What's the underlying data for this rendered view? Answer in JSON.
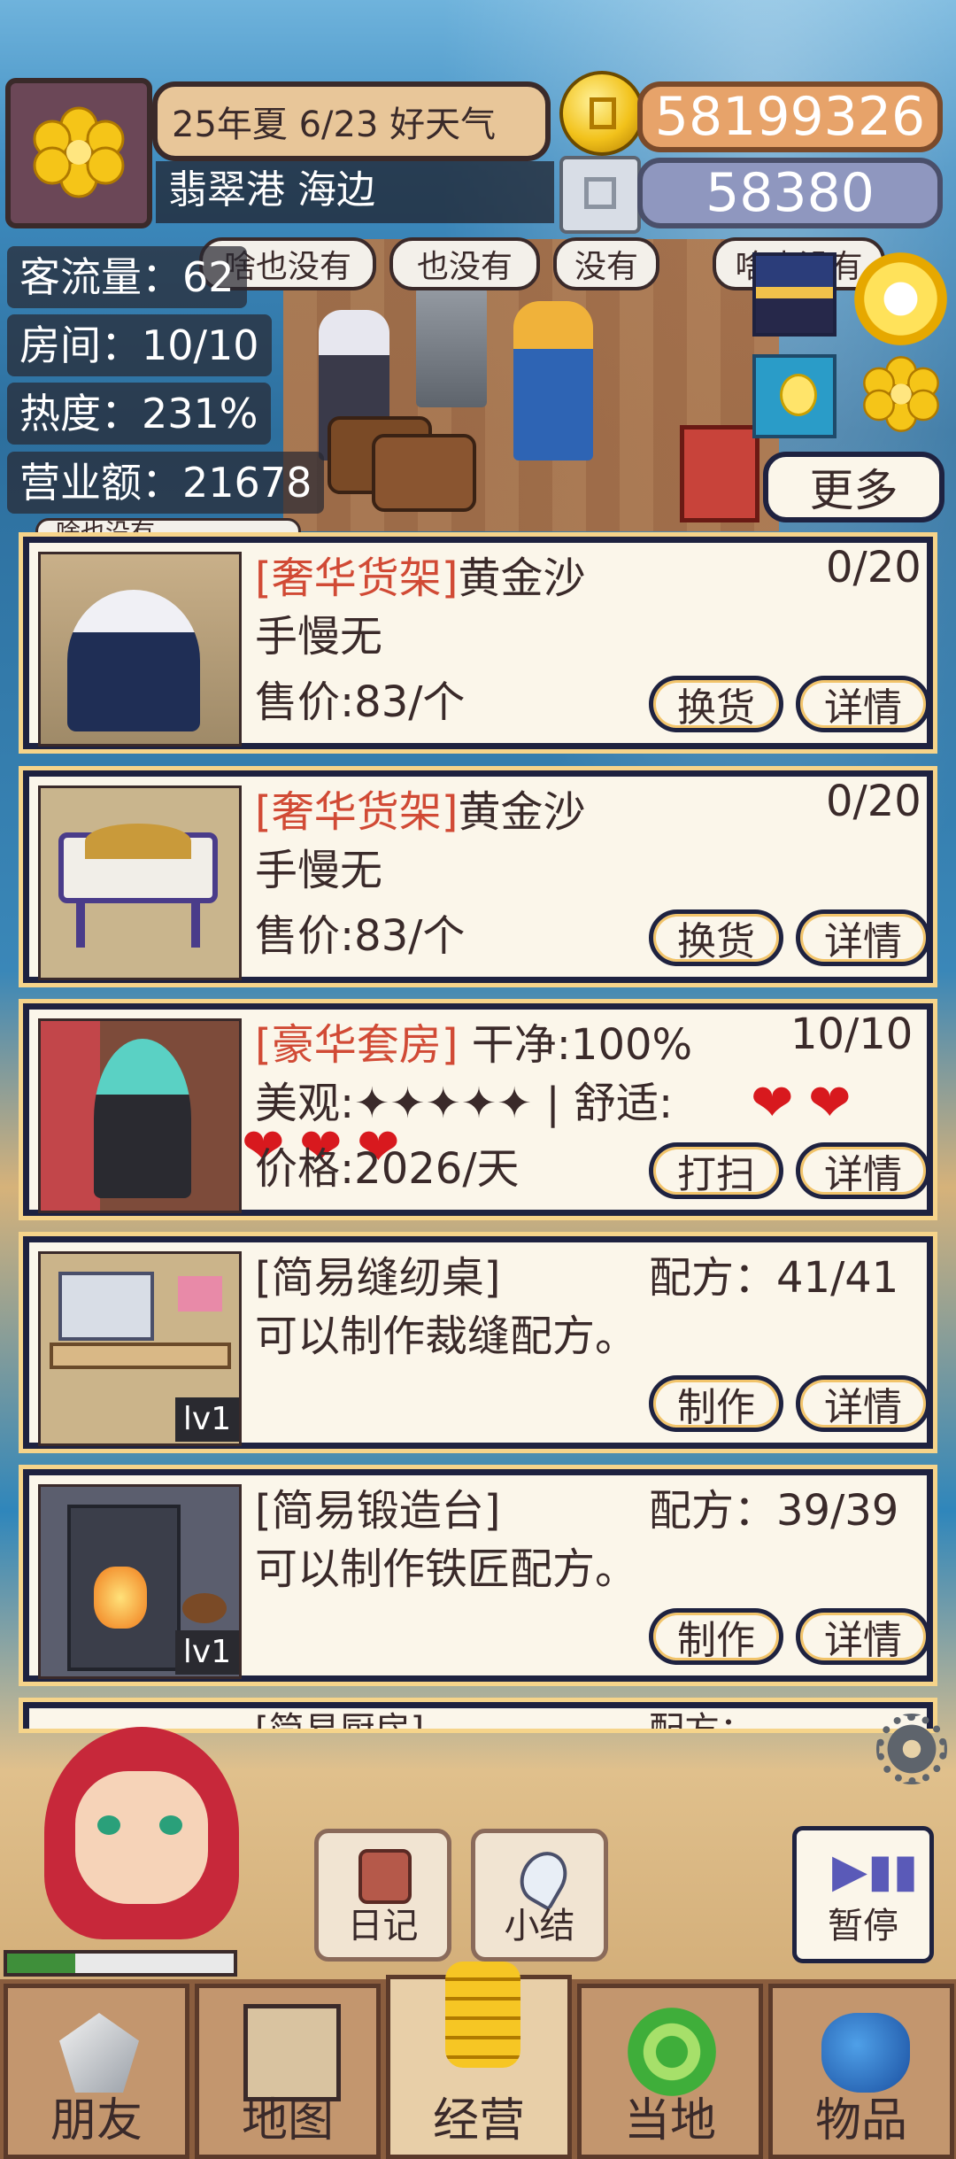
{
  "header": {
    "date_weather": "25年夏 6/23 好天气",
    "location": "翡翠港 海边",
    "gold": "58199326",
    "silver": "58380"
  },
  "stats": {
    "traffic": "客流量：62",
    "rooms": "房间：10/10",
    "heat": "热度：231%",
    "revenue": "营业额：21678"
  },
  "speech_bubbles": [
    "啥也没有",
    "也没有",
    "没有",
    "啥也没有"
  ],
  "partial_bubble": "啥也没有",
  "more_button": "更多",
  "cards": [
    {
      "tag": "[奢华货架]",
      "name": "黄金沙",
      "count": "0/20",
      "line2": "手慢无",
      "line3": "售价:83/个",
      "btn1": "换货",
      "btn2": "详情"
    },
    {
      "tag": "[奢华货架]",
      "name": "黄金沙",
      "count": "0/20",
      "line2": "手慢无",
      "line3": "售价:83/个",
      "btn1": "换货",
      "btn2": "详情"
    },
    {
      "tag": "[豪华套房]",
      "name": " 干净:100%",
      "count": "10/10",
      "line2": "美观:✦✦✦✦✦ | 舒适: ",
      "line3": "价格:2026/天",
      "btn1": "打扫",
      "btn2": "详情"
    },
    {
      "tag": "",
      "name": "[简易缝纫桌]",
      "count": "配方：41/41",
      "line2": "可以制作裁缝配方。",
      "line3": "",
      "btn1": "制作",
      "btn2": "详情",
      "level": "lv1"
    },
    {
      "tag": "",
      "name": "[简易锻造台]",
      "count": "配方：39/39",
      "line2": "可以制作铁匠配方。",
      "line3": "",
      "btn1": "制作",
      "btn2": "详情",
      "level": "lv1"
    }
  ],
  "partial_card": {
    "name": "[简易厨房]",
    "count": "配方："
  },
  "actions": {
    "diary": "日记",
    "summary": "小结",
    "pause": "暂停"
  },
  "nav": [
    "朋友",
    "地图",
    "经营",
    "当地",
    "物品"
  ],
  "colors": {
    "tag_red": "#d14a35",
    "card_border": "#1e2240",
    "heart": "#d8191e"
  }
}
